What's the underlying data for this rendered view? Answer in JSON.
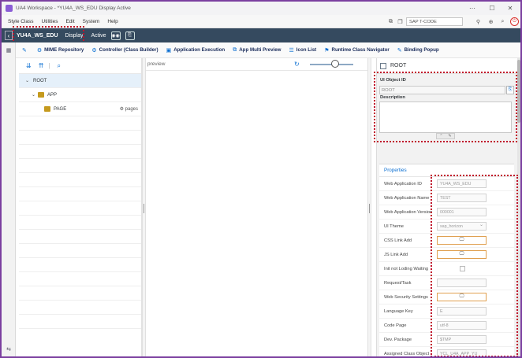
{
  "window": {
    "title": "UA4 Workspace - *YU4A_WS_EDU Display Active"
  },
  "menubar": {
    "items": [
      "Style Class",
      "Utilities",
      "Edit",
      "System",
      "Help"
    ],
    "tcode_placeholder": "SAP T-CODE"
  },
  "shellbar": {
    "app_name": "YU4A_WS_EDU",
    "mode": "Display",
    "status": "Active"
  },
  "toolbar": {
    "items": [
      {
        "label": "MIME Repository",
        "icon": "mime-icon"
      },
      {
        "label": "Controller (Class Builder)",
        "icon": "controller-icon"
      },
      {
        "label": "Application Execution",
        "icon": "execute-icon"
      },
      {
        "label": "App Multi Preview",
        "icon": "preview-icon"
      },
      {
        "label": "Icon List",
        "icon": "list-icon"
      },
      {
        "label": "Runtime Class Navigator",
        "icon": "navigator-icon"
      },
      {
        "label": "Binding Popup",
        "icon": "binding-icon"
      }
    ]
  },
  "tree": {
    "nodes": [
      {
        "label": "ROOT"
      },
      {
        "label": "APP"
      },
      {
        "label": "PAGE",
        "aux": "pages"
      }
    ]
  },
  "preview": {
    "title": "preview"
  },
  "right_panel": {
    "header": "ROOT",
    "ui_object_id_label": "UI Object ID",
    "ui_object_id_value": "ROOT",
    "description_label": "Description",
    "properties_title": "Properties",
    "properties": [
      {
        "label": "Web Application ID",
        "value": "YU4A_WS_EDU",
        "kind": "text"
      },
      {
        "label": "Web Application Name",
        "value": "TEST",
        "kind": "text"
      },
      {
        "label": "Web Application Version",
        "value": "000001",
        "kind": "text"
      },
      {
        "label": "UI Theme",
        "value": "sap_horizon",
        "kind": "select"
      },
      {
        "label": "CSS Link Add",
        "value": "",
        "kind": "button"
      },
      {
        "label": "JS Link Add",
        "value": "",
        "kind": "button"
      },
      {
        "label": "Init not Loding Waiting",
        "value": "",
        "kind": "checkbox"
      },
      {
        "label": "Request/Task",
        "value": "",
        "kind": "text"
      },
      {
        "label": "Web Security Settings",
        "value": "",
        "kind": "button"
      },
      {
        "label": "Language Key",
        "value": "E",
        "kind": "text"
      },
      {
        "label": "Code Page",
        "value": "utf-8",
        "kind": "text"
      },
      {
        "label": "Dev. Package",
        "value": "$TMP",
        "kind": "text"
      },
      {
        "label": "Assigned Class Object",
        "value": "YCL_U4A_APP_YU",
        "kind": "text"
      }
    ]
  }
}
